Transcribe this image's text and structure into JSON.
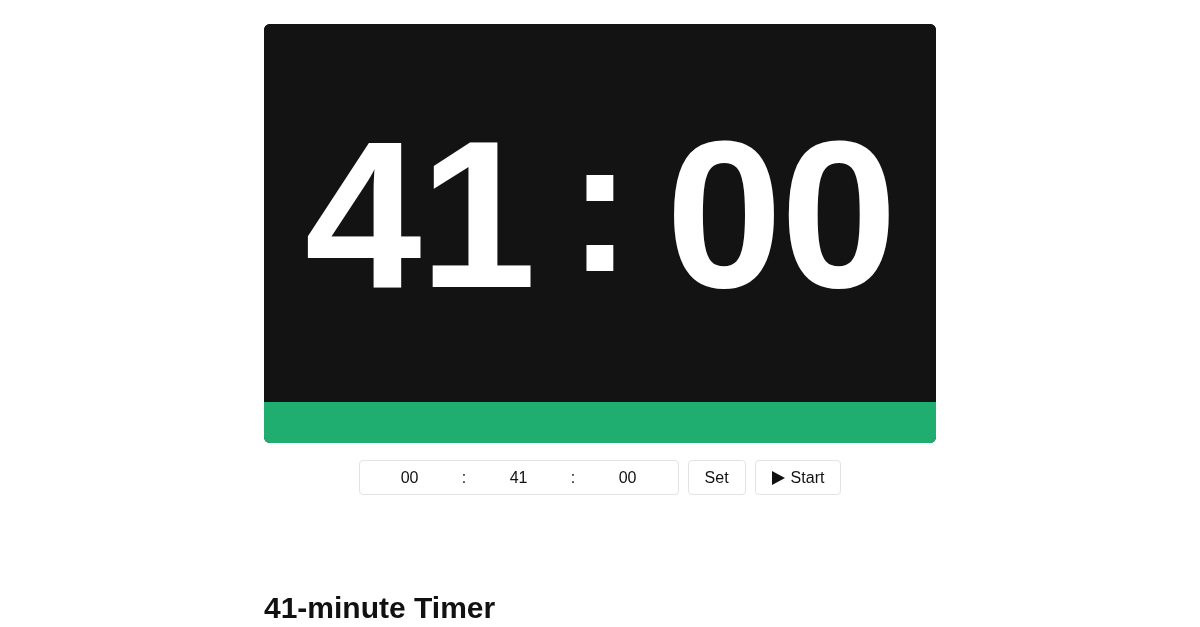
{
  "timer": {
    "minutes": "41",
    "separator": ":",
    "seconds": "00",
    "progress": {
      "level": 1
    }
  },
  "time_input": {
    "fields": [
      {
        "value": "00"
      },
      {
        "value": "41"
      },
      {
        "value": "00"
      }
    ],
    "separators": [
      ":",
      ":"
    ]
  },
  "buttons": [
    {
      "kind": "set",
      "label": "Set"
    },
    {
      "kind": "start",
      "label": "Start"
    }
  ],
  "heading": "41-minute Timer"
}
